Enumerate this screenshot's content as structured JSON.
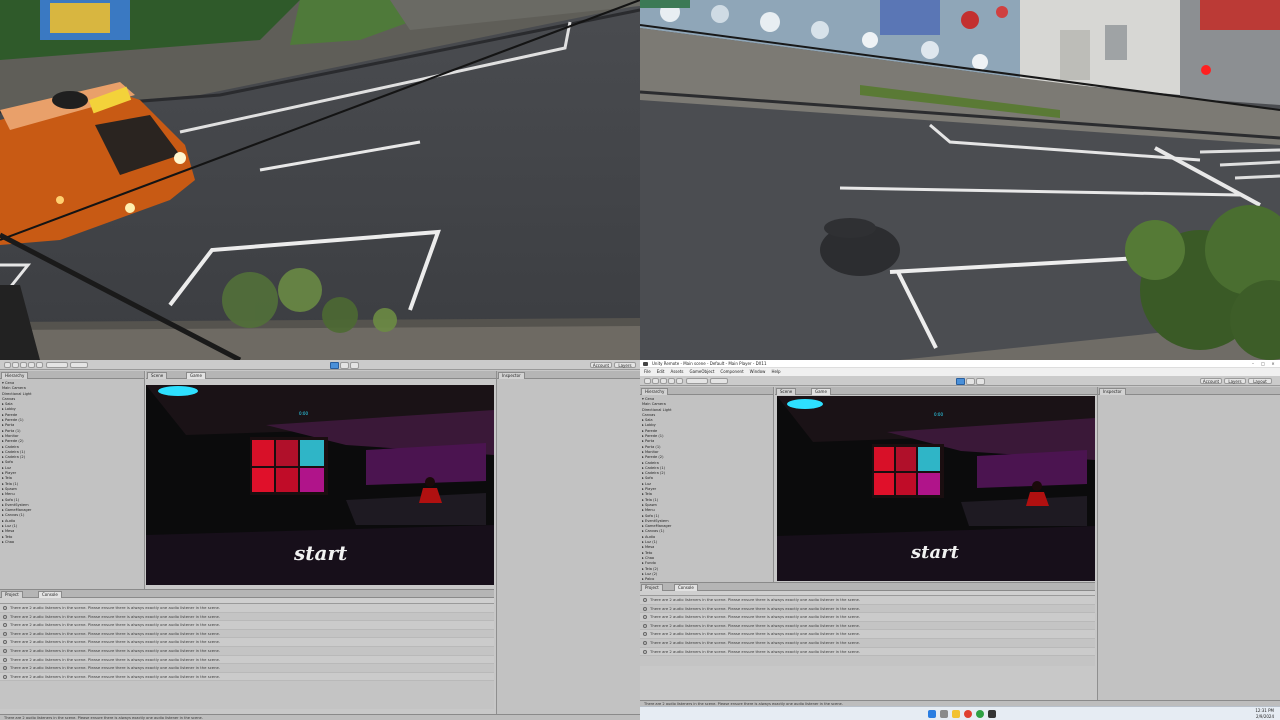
{
  "camera_feeds": [
    {
      "id": "feed-top-left",
      "description_visible": false
    },
    {
      "id": "feed-top-right",
      "description_visible": false
    }
  ],
  "unity_left": {
    "toolbar": {
      "play_label": "▶",
      "pause_label": "❚❚",
      "step_label": "▶❚",
      "right_buttons": [
        "Account",
        "Layers",
        "Layout"
      ]
    },
    "tabs": {
      "hierarchy": "Hierarchy",
      "game": "Game",
      "scene": "Scene",
      "inspector": "Inspector",
      "project": "Project",
      "console": "Console"
    },
    "hierarchy_items": [
      "▾ Cena",
      "  Main Camera",
      "  Directional Light",
      "  Canvas",
      "▸ Sala",
      "▸ Lobby",
      "▸ Parede",
      "▸ Parede (1)",
      "▸ Porta",
      "▸ Porta (1)",
      "▸ Monitor",
      "▸ Parede (2)",
      "▸ Cadeira",
      "▸ Cadeira (1)",
      "▸ Cadeira (2)",
      "▸ Sofa",
      "▸ Luz",
      "▸ Player",
      "▸ Tela",
      "▸ Tela (1)",
      "▸ Spawn",
      "▸ Menu",
      "▸ Sofa (1)",
      "▸ EventSystem",
      "▸ GameManager",
      "▸ Canvas (1)",
      "▸ Audio",
      "▸ Luz (1)",
      "▸ Mesa",
      "▸ Teto",
      "▸ Chao"
    ],
    "game_title": "start",
    "timer": "0:00",
    "logs": [
      "There are 2 audio listeners in the scene. Please ensure there is always exactly one audio listener in the scene.",
      "There are 2 audio listeners in the scene. Please ensure there is always exactly one audio listener in the scene.",
      "There are 2 audio listeners in the scene. Please ensure there is always exactly one audio listener in the scene.",
      "There are 2 audio listeners in the scene. Please ensure there is always exactly one audio listener in the scene.",
      "There are 2 audio listeners in the scene. Please ensure there is always exactly one audio listener in the scene.",
      "There are 2 audio listeners in the scene. Please ensure there is always exactly one audio listener in the scene.",
      "There are 2 audio listeners in the scene. Please ensure there is always exactly one audio listener in the scene.",
      "There are 2 audio listeners in the scene. Please ensure there is always exactly one audio listener in the scene.",
      "There are 2 audio listeners in the scene. Please ensure there is always exactly one audio listener in the scene."
    ],
    "status": "There are 2 audio listeners in the scene. Please ensure there is always exactly one audio listener in the scene."
  },
  "unity_right": {
    "window_title": "Unity Remote - Main scene - Default - Main Player - DX11",
    "menu": [
      "File",
      "Edit",
      "Assets",
      "GameObject",
      "Component",
      "Window",
      "Help"
    ],
    "toolbar": {
      "play_label": "▶",
      "pause_label": "❚❚",
      "step_label": "▶❚",
      "right_buttons": [
        "Account",
        "Layers",
        "Layout"
      ]
    },
    "tabs": {
      "hierarchy": "Hierarchy",
      "game": "Game",
      "scene": "Scene",
      "inspector": "Inspector",
      "project": "Project",
      "console": "Console"
    },
    "hierarchy_items": [
      "▾ Cena",
      "  Main Camera",
      "  Directional Light",
      "  Canvas",
      "▸ Sala",
      "▸ Lobby",
      "▸ Parede",
      "▸ Parede (1)",
      "▸ Porta",
      "▸ Porta (1)",
      "▸ Monitor",
      "▸ Parede (2)",
      "▸ Cadeira",
      "▸ Cadeira (1)",
      "▸ Cadeira (2)",
      "▸ Sofa",
      "▸ Luz",
      "▸ Player",
      "▸ Tela",
      "▸ Tela (1)",
      "▸ Spawn",
      "▸ Menu",
      "▸ Sofa (1)",
      "▸ EventSystem",
      "▸ GameManager",
      "▸ Canvas (1)",
      "▸ Audio",
      "▸ Luz (1)",
      "▸ Mesa",
      "▸ Teto",
      "▸ Chao",
      "▸ Fundo",
      "▸ Tela (2)",
      "▸ Luz (2)",
      "▸ Palco"
    ],
    "game_title": "start",
    "timer": "0:00",
    "logs": [
      "There are 2 audio listeners in the scene. Please ensure there is always exactly one audio listener in the scene.",
      "There are 2 audio listeners in the scene. Please ensure there is always exactly one audio listener in the scene.",
      "There are 2 audio listeners in the scene. Please ensure there is always exactly one audio listener in the scene.",
      "There are 2 audio listeners in the scene. Please ensure there is always exactly one audio listener in the scene.",
      "There are 2 audio listeners in the scene. Please ensure there is always exactly one audio listener in the scene.",
      "There are 2 audio listeners in the scene. Please ensure there is always exactly one audio listener in the scene.",
      "There are 2 audio listeners in the scene. Please ensure there is always exactly one audio listener in the scene."
    ],
    "status": "There are 2 audio listeners in the scene. Please ensure there is always exactly one audio listener in the scene.",
    "clock_time": "12:31 PM",
    "clock_date": "2/9/2024"
  },
  "colors": {
    "accent_play": "#4a90d9",
    "game_screen_red": "#e0102a",
    "game_screen_cyan": "#2fb5c7",
    "game_purple": "#5a1a60",
    "cyan_light": "#2ee0ff"
  }
}
